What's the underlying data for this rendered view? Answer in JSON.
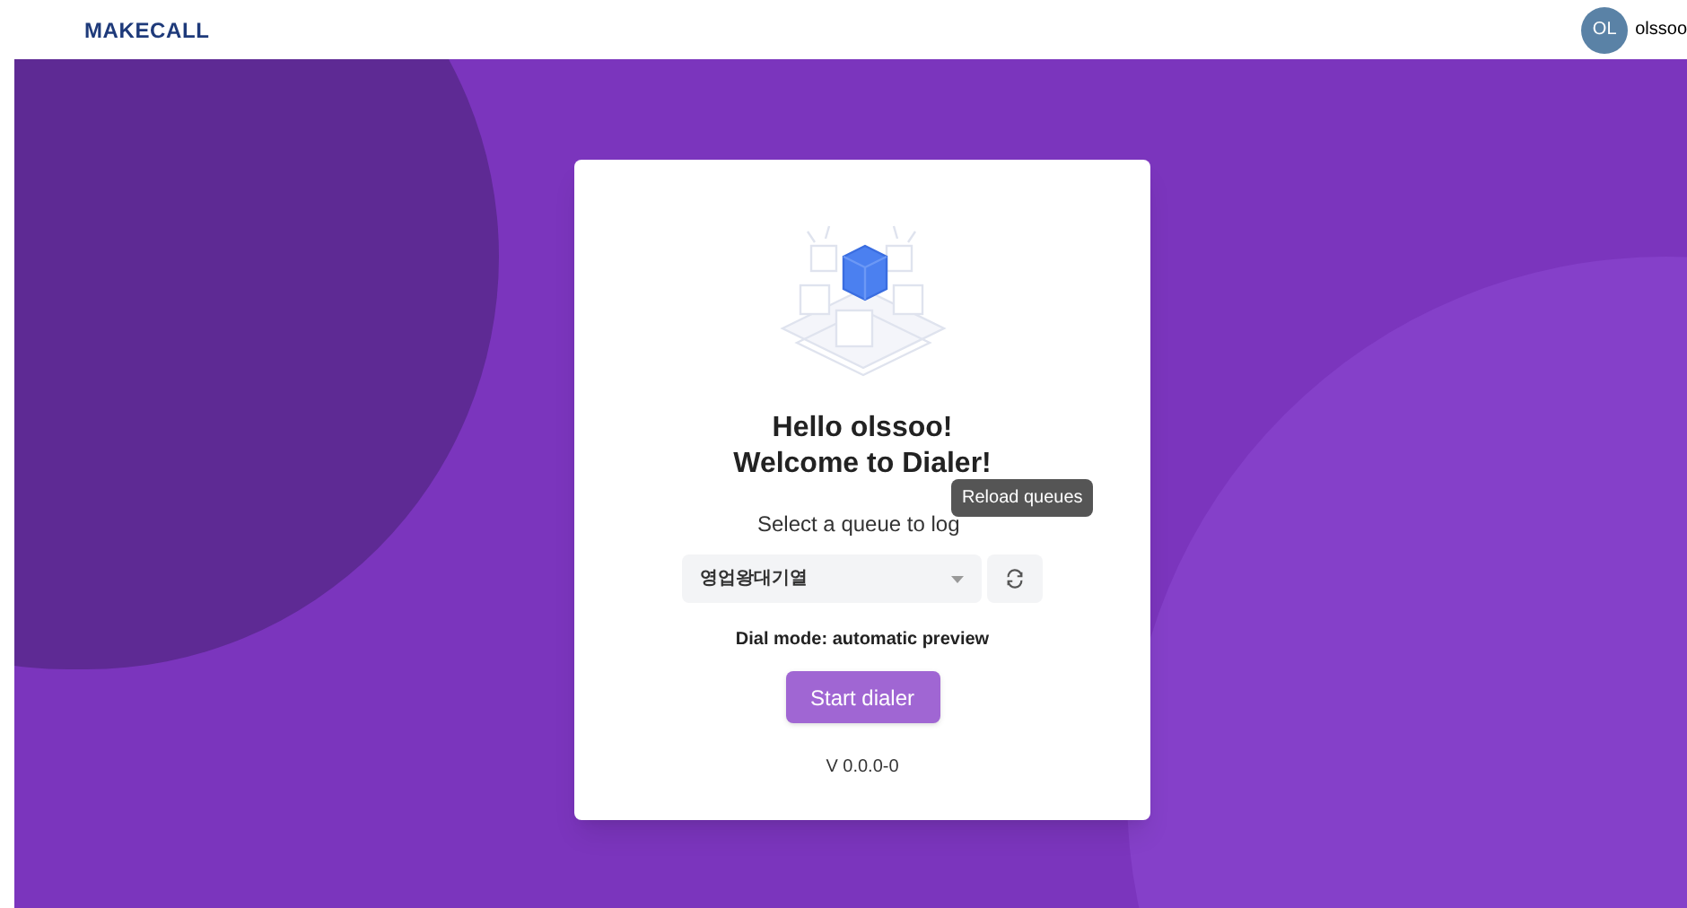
{
  "header": {
    "logo": "MAKECALL",
    "avatar_initials": "OL",
    "username": "olssoo"
  },
  "card": {
    "greeting": "Hello olssoo!",
    "welcome": "Welcome to Dialer!",
    "prompt": "Select a queue to log",
    "queue_select": {
      "value": "영업왕대기열"
    },
    "tooltip": "Reload queues",
    "dial_mode": "Dial mode: automatic preview",
    "start_button": "Start dialer",
    "version": "V 0.0.0-0"
  }
}
